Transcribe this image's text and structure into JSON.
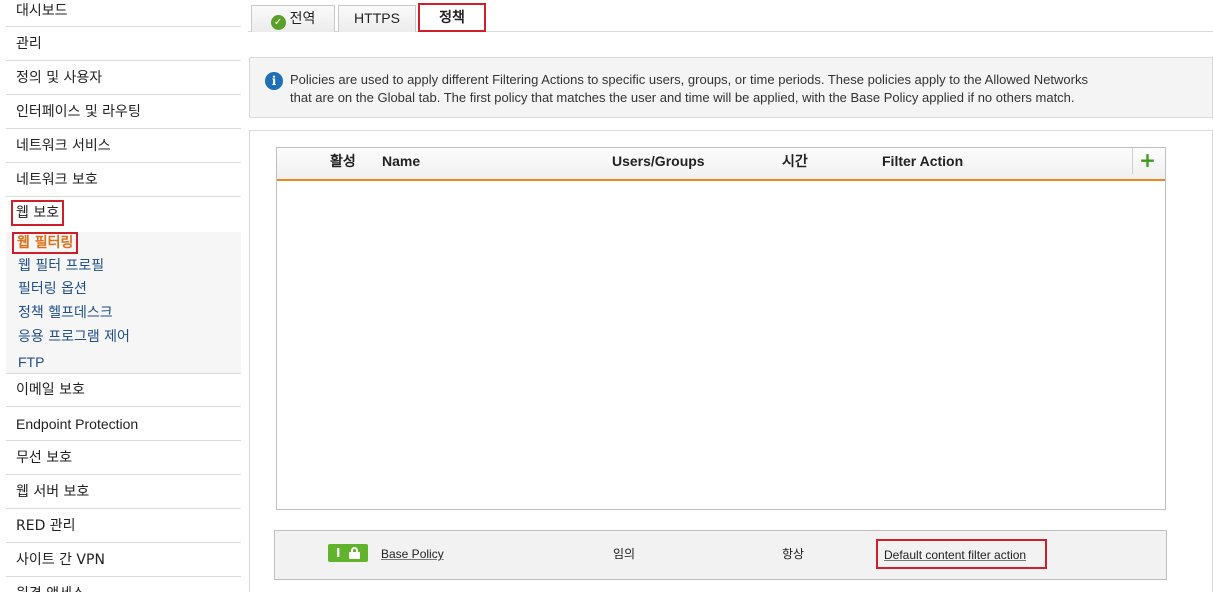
{
  "sidebar": {
    "items": [
      {
        "label": "대시보드"
      },
      {
        "label": "관리"
      },
      {
        "label": "정의 및 사용자"
      },
      {
        "label": "인터페이스 및 라우팅"
      },
      {
        "label": "네트워크 서비스"
      },
      {
        "label": "네트워크 보호"
      },
      {
        "label": "웹 보호"
      },
      {
        "label": "이메일 보호"
      },
      {
        "label": "Endpoint Protection"
      },
      {
        "label": "무선 보호"
      },
      {
        "label": "웹 서버 보호"
      },
      {
        "label": "RED 관리"
      },
      {
        "label": "사이트 간 VPN"
      },
      {
        "label": "원격 액세스"
      }
    ],
    "web_protection_sub": [
      {
        "label": "웹 필터링",
        "active": true
      },
      {
        "label": "웹 필터 프로필"
      },
      {
        "label": "필터링 옵션"
      },
      {
        "label": "정책 헬프데스크"
      },
      {
        "label": "응용 프로그램 제어"
      },
      {
        "label": "FTP"
      }
    ]
  },
  "tabs": [
    {
      "label": "전역",
      "icon": "check-circle-icon"
    },
    {
      "label": "HTTPS"
    },
    {
      "label": "정책",
      "active": true
    }
  ],
  "info": {
    "icon": "info-icon",
    "line1": "Policies are used to apply different Filtering Actions to specific users, groups, or time periods. These policies apply to the Allowed Networks",
    "line2": "that are on the Global tab. The first policy that matches the user and time will be applied, with the Base Policy applied if no others match."
  },
  "policy_table": {
    "columns": [
      "활성",
      "Name",
      "Users/Groups",
      "시간",
      "Filter Action"
    ],
    "add_icon": "plus-icon",
    "rows": []
  },
  "base_policy": {
    "toggle_label": "I",
    "lock_icon": "lock-icon",
    "name": "Base Policy",
    "users_groups": "임의",
    "time": "항상",
    "filter_action": "Default content filter action"
  },
  "colors": {
    "accent_orange": "#e8891e",
    "highlight_red": "#d01f2b",
    "toggle_green": "#61b32c",
    "info_blue": "#1d6fb7",
    "link_blue": "#1f4f8c"
  }
}
